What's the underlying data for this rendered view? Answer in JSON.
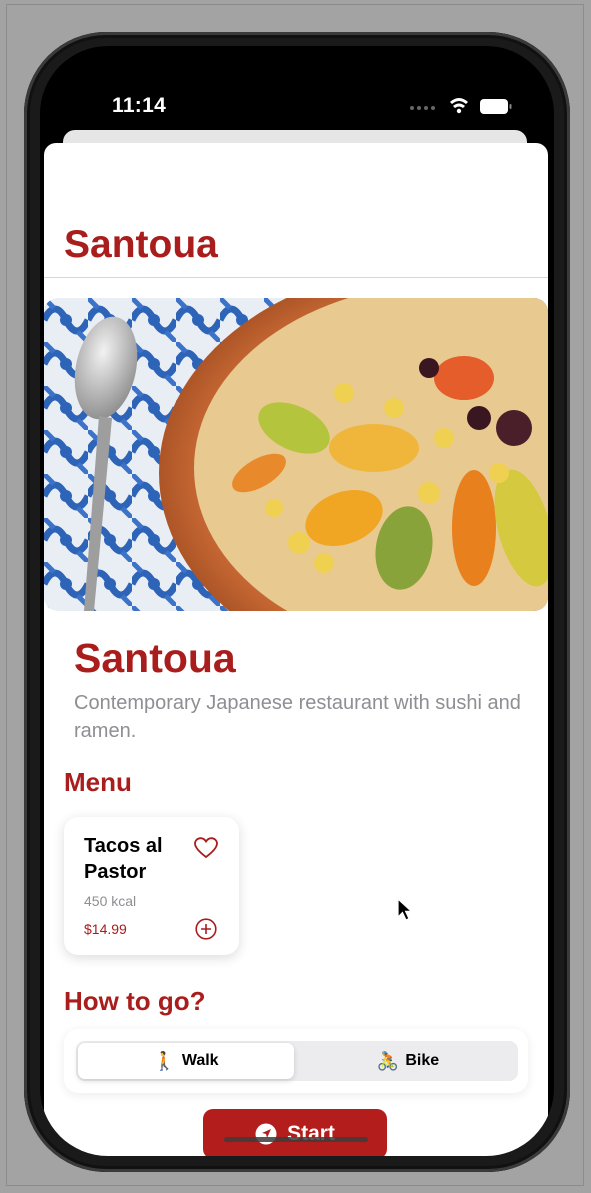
{
  "status_bar": {
    "time": "11:14"
  },
  "nav": {
    "title": "Santoua"
  },
  "hero": {
    "image_description": "couscous-dish-photo"
  },
  "restaurant": {
    "name": "Santoua",
    "description": "Contemporary Japanese restaurant with sushi and ramen."
  },
  "menu": {
    "section_title": "Menu",
    "items": [
      {
        "name": "Tacos al Pastor",
        "calories": "450 kcal",
        "price": "$14.99"
      }
    ]
  },
  "directions": {
    "section_title": "How to go?",
    "options": [
      {
        "emoji": "🚶",
        "label": "Walk",
        "selected": true
      },
      {
        "emoji": "🚴",
        "label": "Bike",
        "selected": false
      }
    ],
    "start_label": "Start"
  },
  "colors": {
    "accent": "#a91d1c",
    "secondary_text": "#8e8e93"
  }
}
